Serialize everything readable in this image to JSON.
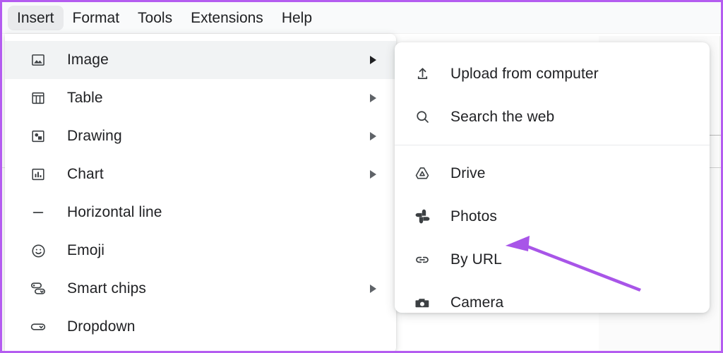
{
  "app": {
    "name": "Google Docs",
    "accent_purple": "#b45cf0",
    "menu_highlight": "#f1f3f4",
    "text_color": "#202124",
    "icon_color": "#3c4043"
  },
  "menubar": {
    "items": [
      {
        "label": "Insert",
        "active": true
      },
      {
        "label": "Format",
        "active": false
      },
      {
        "label": "Tools",
        "active": false
      },
      {
        "label": "Extensions",
        "active": false
      },
      {
        "label": "Help",
        "active": false
      }
    ]
  },
  "insert_menu": {
    "items": [
      {
        "label": "Image",
        "icon": "image-icon",
        "has_submenu": true,
        "highlighted": true
      },
      {
        "label": "Table",
        "icon": "table-icon",
        "has_submenu": true,
        "highlighted": false
      },
      {
        "label": "Drawing",
        "icon": "drawing-icon",
        "has_submenu": true,
        "highlighted": false
      },
      {
        "label": "Chart",
        "icon": "chart-icon",
        "has_submenu": true,
        "highlighted": false
      },
      {
        "label": "Horizontal line",
        "icon": "horizontal-line-icon",
        "has_submenu": false,
        "highlighted": false
      },
      {
        "label": "Emoji",
        "icon": "emoji-icon",
        "has_submenu": false,
        "highlighted": false
      },
      {
        "label": "Smart chips",
        "icon": "smart-chips-icon",
        "has_submenu": true,
        "highlighted": false
      },
      {
        "label": "Dropdown",
        "icon": "dropdown-icon",
        "has_submenu": false,
        "highlighted": false
      }
    ]
  },
  "image_submenu": {
    "group_one": [
      {
        "label": "Upload from computer",
        "icon": "upload-icon"
      },
      {
        "label": "Search the web",
        "icon": "search-icon"
      }
    ],
    "group_two": [
      {
        "label": "Drive",
        "icon": "drive-icon"
      },
      {
        "label": "Photos",
        "icon": "photos-icon"
      },
      {
        "label": "By URL",
        "icon": "link-icon"
      },
      {
        "label": "Camera",
        "icon": "camera-icon"
      }
    ]
  },
  "annotation": {
    "type": "arrow",
    "color": "#a855e8",
    "points_to": "By URL",
    "direction": "up-left"
  }
}
